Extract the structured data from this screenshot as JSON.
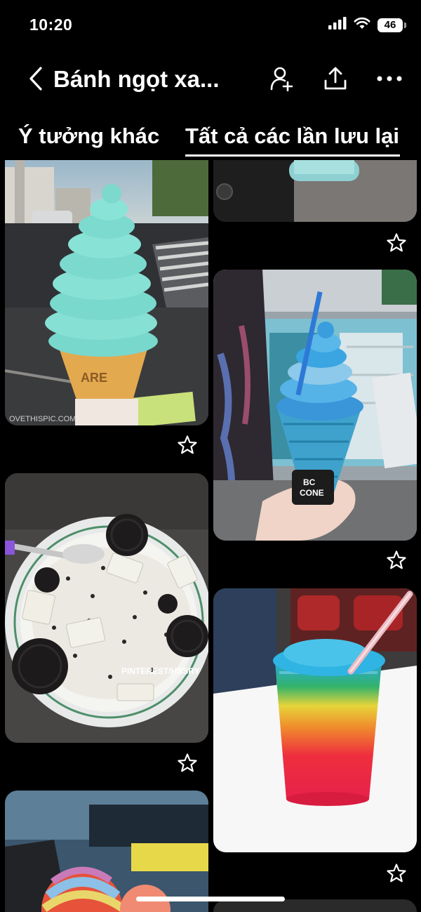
{
  "status_bar": {
    "time": "10:20",
    "battery": "46"
  },
  "header": {
    "title": "Bánh ngọt xa..."
  },
  "tabs": {
    "ideas": "Ý tưởng khác",
    "saved": "Tất cả các lần lưu lại"
  },
  "pins": {
    "mint_cone": {
      "watermark": "OVETHISPIC.COM",
      "cone_text": "ARE"
    },
    "blue_cone": {
      "cup_text_1": "BC",
      "cup_text_2": "CONE"
    },
    "oreo": {
      "watermark": "PINTEREST/HSSRY"
    },
    "rainbow_scoop": {},
    "slushie": {},
    "top_partial": {}
  },
  "colors": {
    "background": "#000000",
    "foreground": "#ffffff"
  }
}
